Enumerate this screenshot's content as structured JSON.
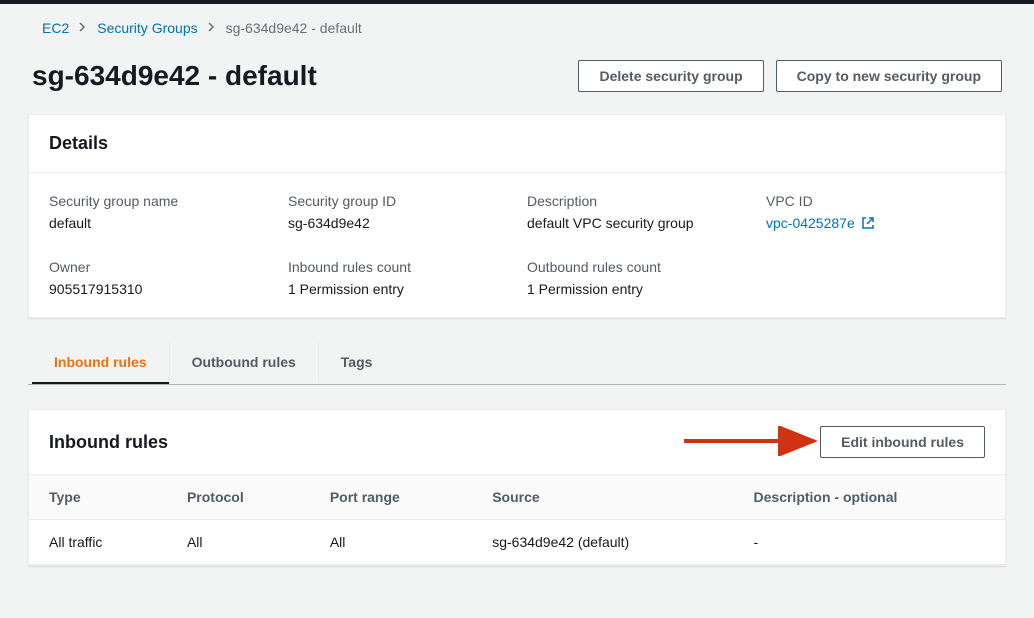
{
  "breadcrumb": {
    "items": [
      {
        "label": "EC2",
        "link": true
      },
      {
        "label": "Security Groups",
        "link": true
      },
      {
        "label": "sg-634d9e42 - default",
        "link": false
      }
    ]
  },
  "page": {
    "title": "sg-634d9e42 - default"
  },
  "header_actions": {
    "delete": "Delete security group",
    "copy": "Copy to new security group"
  },
  "details": {
    "title": "Details",
    "fields": {
      "sg_name": {
        "label": "Security group name",
        "value": "default"
      },
      "sg_id": {
        "label": "Security group ID",
        "value": "sg-634d9e42"
      },
      "description": {
        "label": "Description",
        "value": "default VPC security group"
      },
      "vpc_id": {
        "label": "VPC ID",
        "value": "vpc-0425287e"
      },
      "owner": {
        "label": "Owner",
        "value": "905517915310"
      },
      "inbound_count": {
        "label": "Inbound rules count",
        "value": "1 Permission entry"
      },
      "outbound_count": {
        "label": "Outbound rules count",
        "value": "1 Permission entry"
      }
    }
  },
  "tabs": {
    "inbound": "Inbound rules",
    "outbound": "Outbound rules",
    "tags": "Tags"
  },
  "inbound_panel": {
    "title": "Inbound rules",
    "edit_button": "Edit inbound rules",
    "columns": {
      "type": "Type",
      "protocol": "Protocol",
      "port_range": "Port range",
      "source": "Source",
      "description": "Description - optional"
    },
    "rows": [
      {
        "type": "All traffic",
        "protocol": "All",
        "port_range": "All",
        "source": "sg-634d9e42 (default)",
        "description": "-"
      }
    ]
  }
}
